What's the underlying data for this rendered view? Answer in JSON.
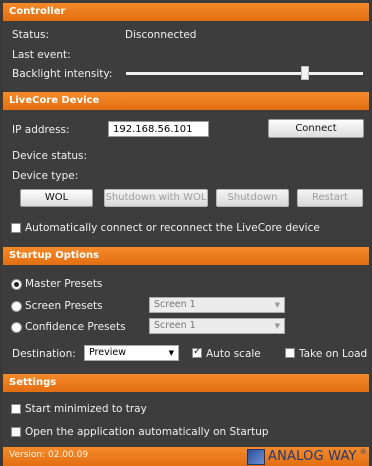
{
  "controller": {
    "header": "Controller",
    "status_label": "Status:",
    "status_value": "Disconnected",
    "last_event_label": "Last event:",
    "backlight_label": "Backlight intensity:"
  },
  "device": {
    "header": "LiveCore Device",
    "ip_label": "IP address:",
    "ip_value": "192.168.56.101",
    "connect_label": "Connect",
    "device_status_label": "Device status:",
    "device_type_label": "Device type:",
    "wol_label": "WOL",
    "shutdown_wol_label": "Shutdown with WOL",
    "shutdown_label": "Shutdown",
    "restart_label": "Restart",
    "auto_connect_label": "Automatically connect or reconnect the LiveCore device"
  },
  "startup": {
    "header": "Startup Options",
    "master_presets": "Master Presets",
    "screen_presets": "Screen Presets",
    "screen_presets_combo": "Screen 1",
    "confidence_presets": "Confidence Presets",
    "confidence_presets_combo": "Screen 1",
    "destination_label": "Destination:",
    "destination_value": "Preview",
    "auto_scale_label": "Auto scale",
    "take_on_load_label": "Take on Load"
  },
  "settings": {
    "header": "Settings",
    "start_minimized": "Start minimized to tray",
    "open_on_startup": "Open the application automatically on Startup"
  },
  "footer": {
    "version": "Version: 02.00.09",
    "brand": "ANALOG WAY",
    "brand_mark": "®"
  },
  "colors": {
    "accent": "#ee7d1c",
    "panel": "#3d3d3d",
    "brand_blue": "#1f3a78"
  }
}
